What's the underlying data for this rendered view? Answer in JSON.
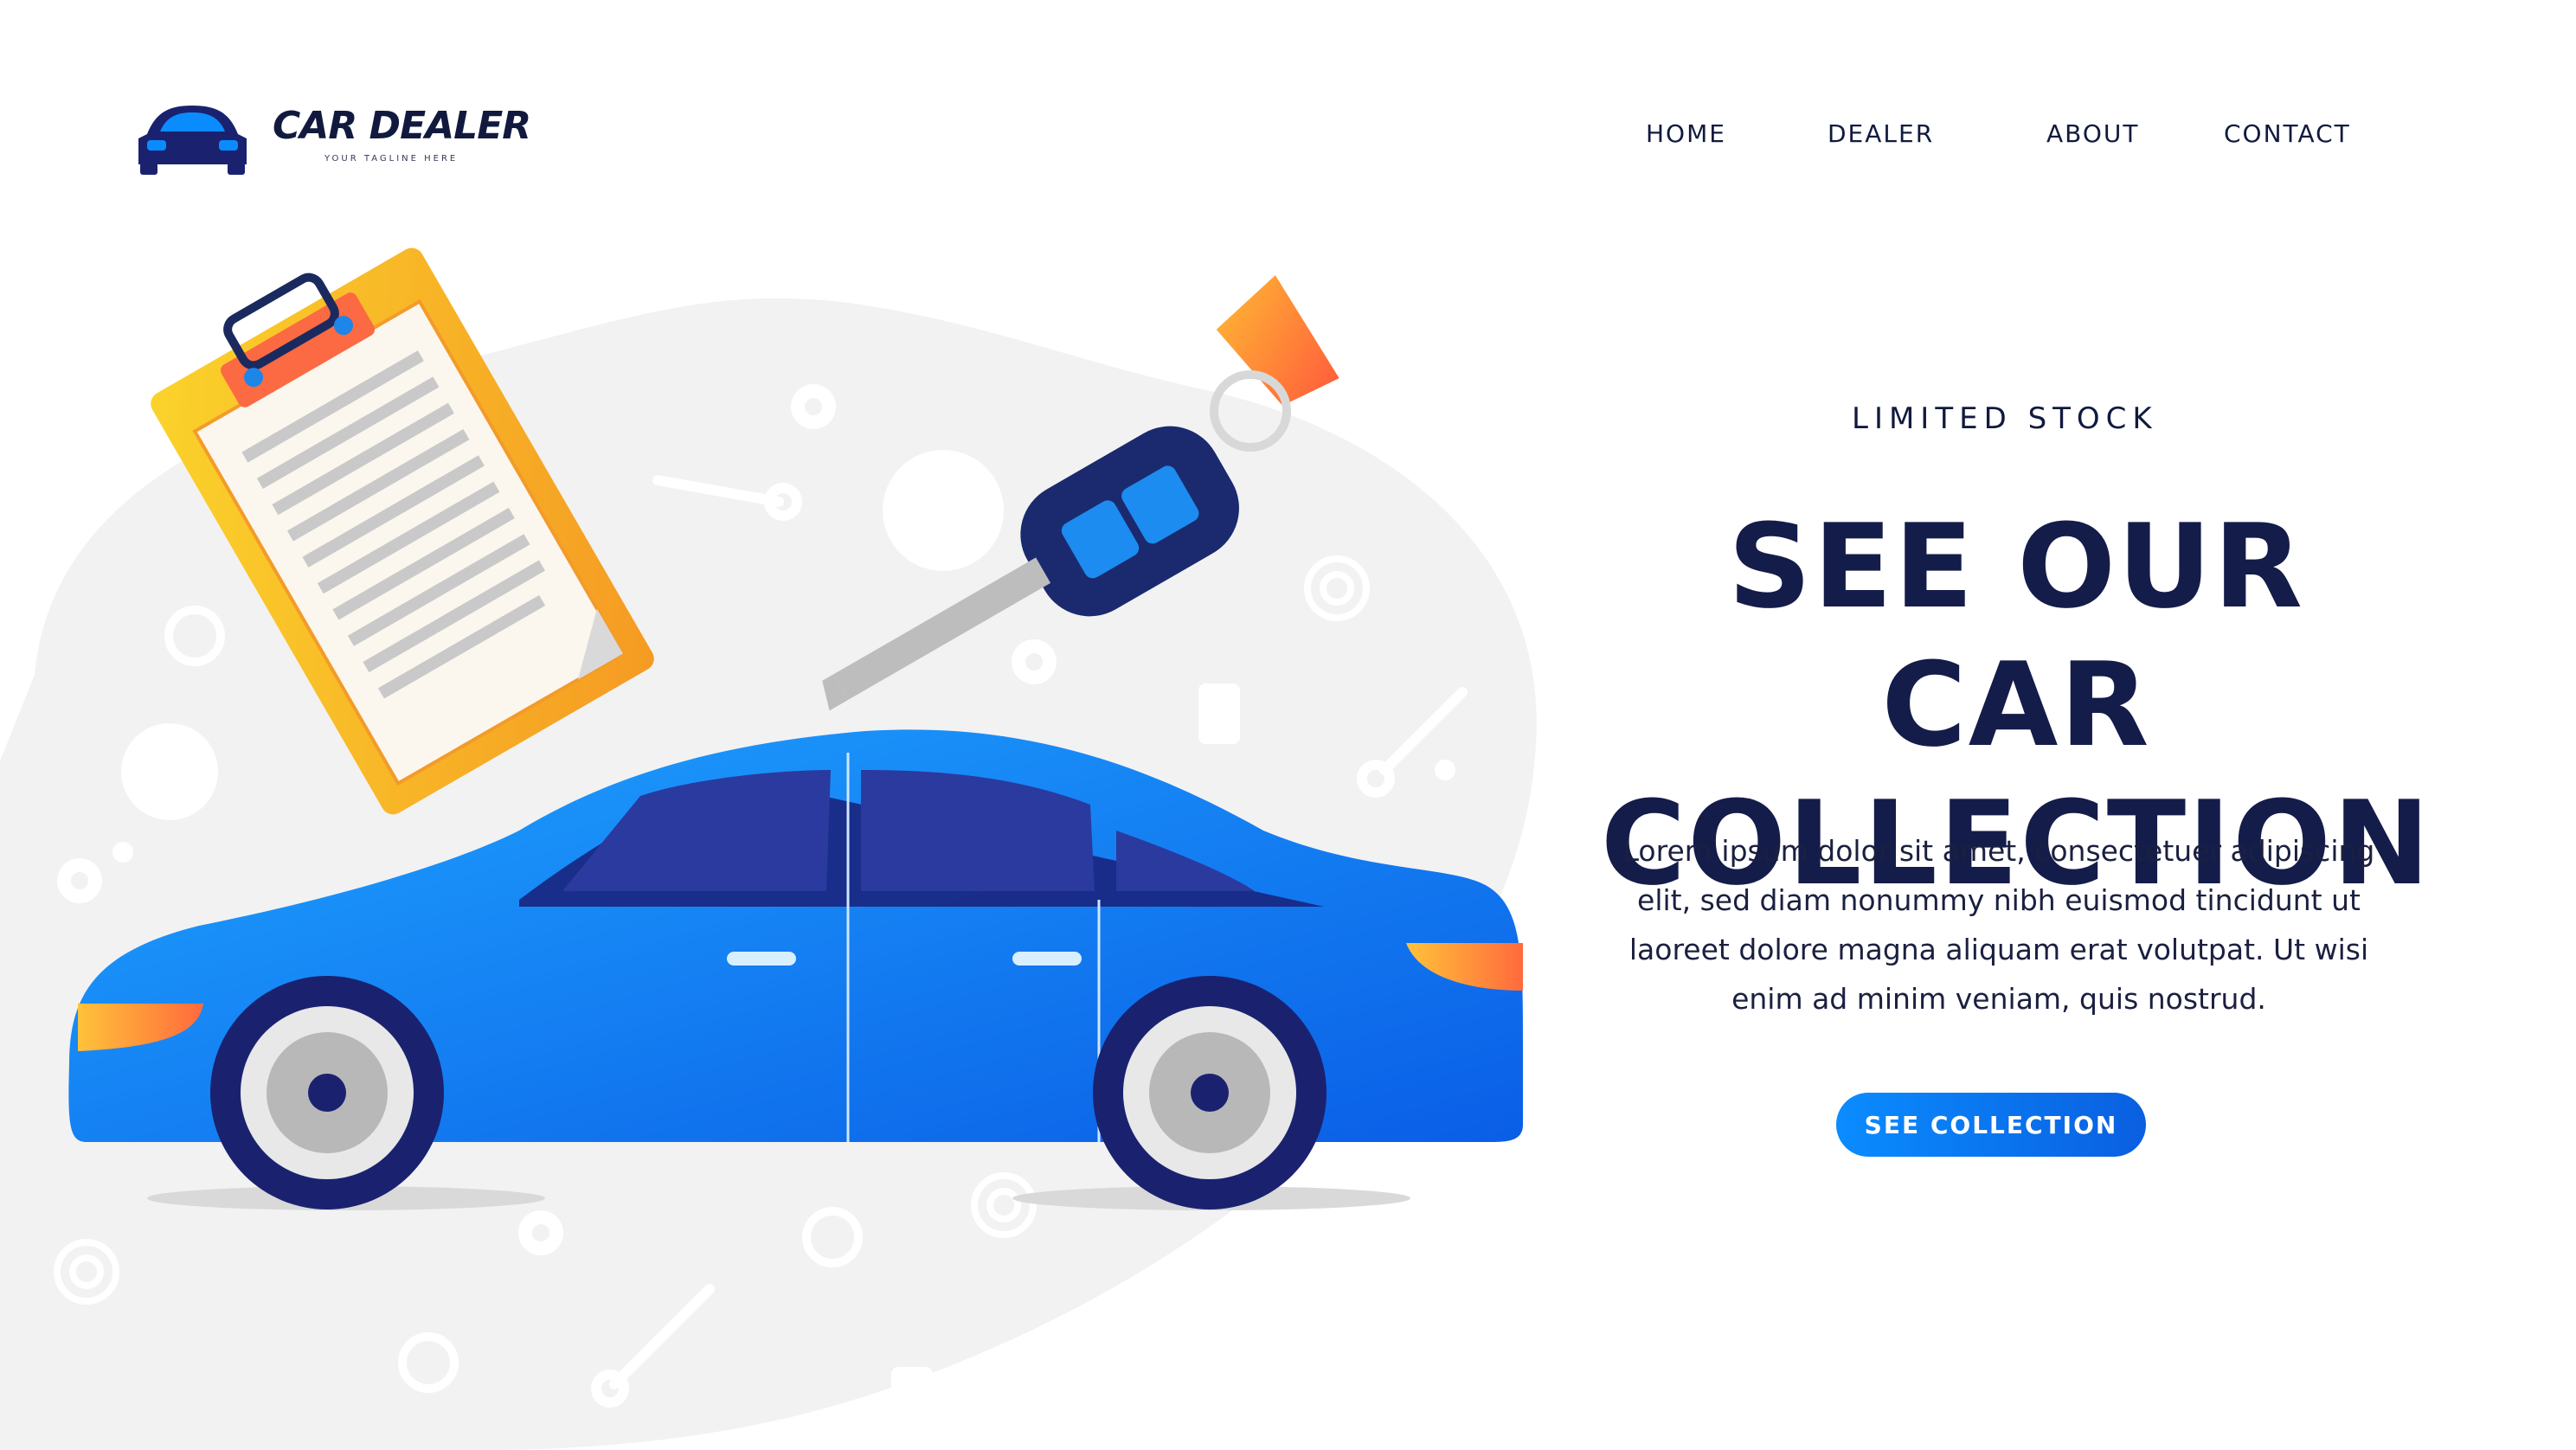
{
  "brand": {
    "name": "CAR DEALER",
    "tagline": "YOUR TAGLINE HERE"
  },
  "nav": {
    "items": [
      "HOME",
      "DEALER",
      "ABOUT",
      "CONTACT"
    ]
  },
  "hero": {
    "eyebrow": "LIMITED STOCK",
    "title_line1": "SEE OUR CAR",
    "title_line2": "COLLECTION",
    "body": "Lorem ipsum dolor sit amet, consectetuer adipiscing elit, sed diam nonummy nibh euismod tincidunt ut laoreet dolore magna aliquam erat volutpat. Ut wisi enim ad minim veniam, quis nostrud.",
    "cta": "SEE COLLECTION"
  },
  "colors": {
    "navy": "#141c4a",
    "blue": "#0a8cff",
    "orange": "#f7b731",
    "gray_blob": "#f2f2f2"
  },
  "illustration": {
    "icons": [
      "clipboard-icon",
      "car-key-icon",
      "car-icon",
      "gear-icon",
      "wrench-icon",
      "steering-wheel-icon",
      "oil-bottle-icon",
      "wheel-icon"
    ]
  }
}
